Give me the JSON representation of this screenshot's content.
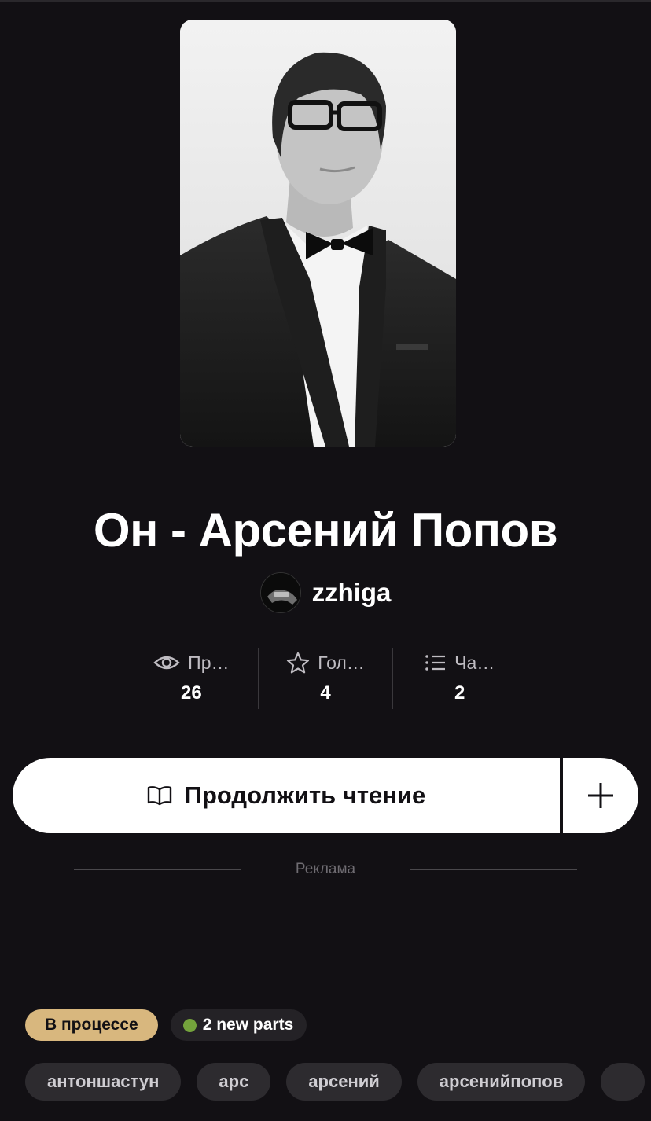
{
  "story": {
    "title": "Он - Арсений Попов",
    "author": "zzhiga"
  },
  "stats": [
    {
      "icon": "eye-icon",
      "label": "Пр…",
      "value": "26"
    },
    {
      "icon": "star-icon",
      "label": "Гол…",
      "value": "4"
    },
    {
      "icon": "list-icon",
      "label": "Ча…",
      "value": "2"
    }
  ],
  "actions": {
    "continue_label": "Продолжить чтение",
    "add_icon": "plus-icon"
  },
  "ad": {
    "label": "Реклама"
  },
  "badges": {
    "status": "В процессе",
    "new_parts": "2 new parts",
    "new_parts_dot_color": "#74a33c"
  },
  "tags": [
    "антоншастун",
    "арс",
    "арсений",
    "арсенийпопов",
    ""
  ],
  "colors": {
    "background": "#121014",
    "status_badge": "#d8b77e",
    "button": "#ffffff"
  }
}
